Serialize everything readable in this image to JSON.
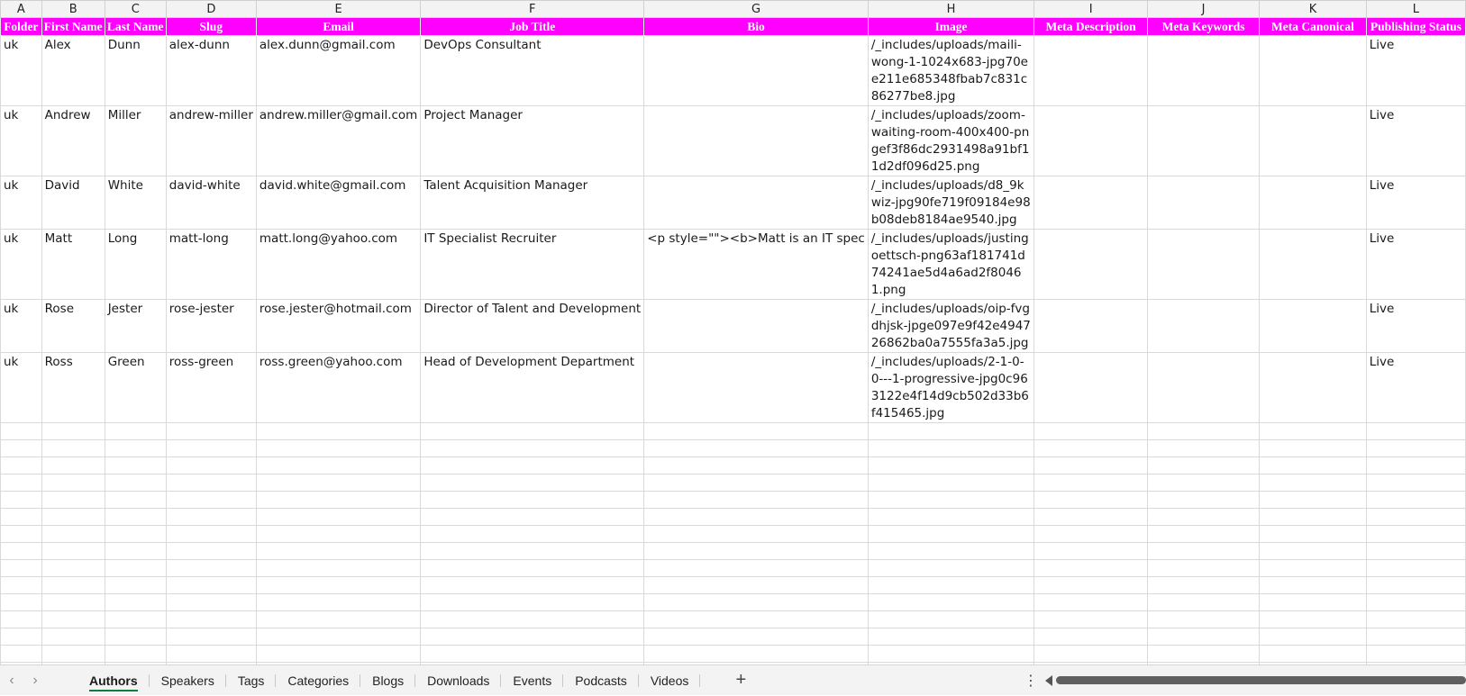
{
  "columns": [
    "A",
    "B",
    "C",
    "D",
    "E",
    "F",
    "G",
    "H",
    "I",
    "J",
    "K",
    "L"
  ],
  "headers": [
    "Folder",
    "First Name",
    "Last Name",
    "Slug",
    "Email",
    "Job Title",
    "Bio",
    "Image",
    "Meta Description",
    "Meta Keywords",
    "Meta Canonical",
    "Publishing Status"
  ],
  "rows": [
    {
      "folder": "uk",
      "first": "Alex",
      "last": "Dunn",
      "slug": "alex-dunn",
      "email": "alex.dunn@gmail.com",
      "job": "DevOps Consultant",
      "bio": "",
      "image": "/_includes/uploads/maili-wong-1-1024x683-jpg70ee211e685348fbab7c831c86277be8.jpg",
      "meta_desc": "",
      "meta_kw": "",
      "meta_can": "",
      "status": "Live"
    },
    {
      "folder": "uk",
      "first": "Andrew",
      "last": "Miller",
      "slug": "andrew-miller",
      "email": "andrew.miller@gmail.com",
      "job": "Project Manager",
      "bio": "",
      "image": "/_includes/uploads/zoom-waiting-room-400x400-pngef3f86dc2931498a91bf11d2df096d25.png",
      "meta_desc": "",
      "meta_kw": "",
      "meta_can": "",
      "status": "Live"
    },
    {
      "folder": "uk",
      "first": "David",
      "last": "White",
      "slug": "david-white",
      "email": "david.white@gmail.com",
      "job": "Talent Acquisition Manager",
      "bio": "",
      "image": "/_includes/uploads/d8_9kwiz-jpg90fe719f09184e98b08deb8184ae9540.jpg",
      "meta_desc": "",
      "meta_kw": "",
      "meta_can": "",
      "status": "Live"
    },
    {
      "folder": "uk",
      "first": "Matt",
      "last": "Long",
      "slug": "matt-long",
      "email": "matt.long@yahoo.com",
      "job": "IT Specialist Recruiter",
      "bio": "<p style=\"\"><b>Matt is an IT spec",
      "image": "/_includes/uploads/justingoettsch-png63af181741d74241ae5d4a6ad2f80461.png",
      "meta_desc": "",
      "meta_kw": "",
      "meta_can": "",
      "status": "Live"
    },
    {
      "folder": "uk",
      "first": "Rose",
      "last": "Jester",
      "slug": "rose-jester",
      "email": "rose.jester@hotmail.com",
      "job": "Director of Talent and Development",
      "bio": "",
      "image": "/_includes/uploads/oip-fvgdhjsk-jpge097e9f42e494726862ba0a7555fa3a5.jpg",
      "meta_desc": "",
      "meta_kw": "",
      "meta_can": "",
      "status": "Live"
    },
    {
      "folder": "uk",
      "first": "Ross",
      "last": "Green",
      "slug": "ross-green",
      "email": "ross.green@yahoo.com",
      "job": "Head of Development Department",
      "bio": "",
      "image": "/_includes/uploads/2-1-0-0---1-progressive-jpg0c963122e4f14d9cb502d33b6f415465.jpg",
      "meta_desc": "",
      "meta_kw": "",
      "meta_can": "",
      "status": "Live"
    }
  ],
  "tabs": [
    "Authors",
    "Speakers",
    "Tags",
    "Categories",
    "Blogs",
    "Downloads",
    "Events",
    "Podcasts",
    "Videos"
  ],
  "active_tab": "Authors",
  "icons": {
    "prev": "chevron-left-icon",
    "next": "chevron-right-icon",
    "add": "plus-icon",
    "more": "more-vertical-icon"
  },
  "colors": {
    "header_bg": "#ff00ff",
    "header_text": "#ffffff",
    "active_tab_underline": "#107c41"
  }
}
